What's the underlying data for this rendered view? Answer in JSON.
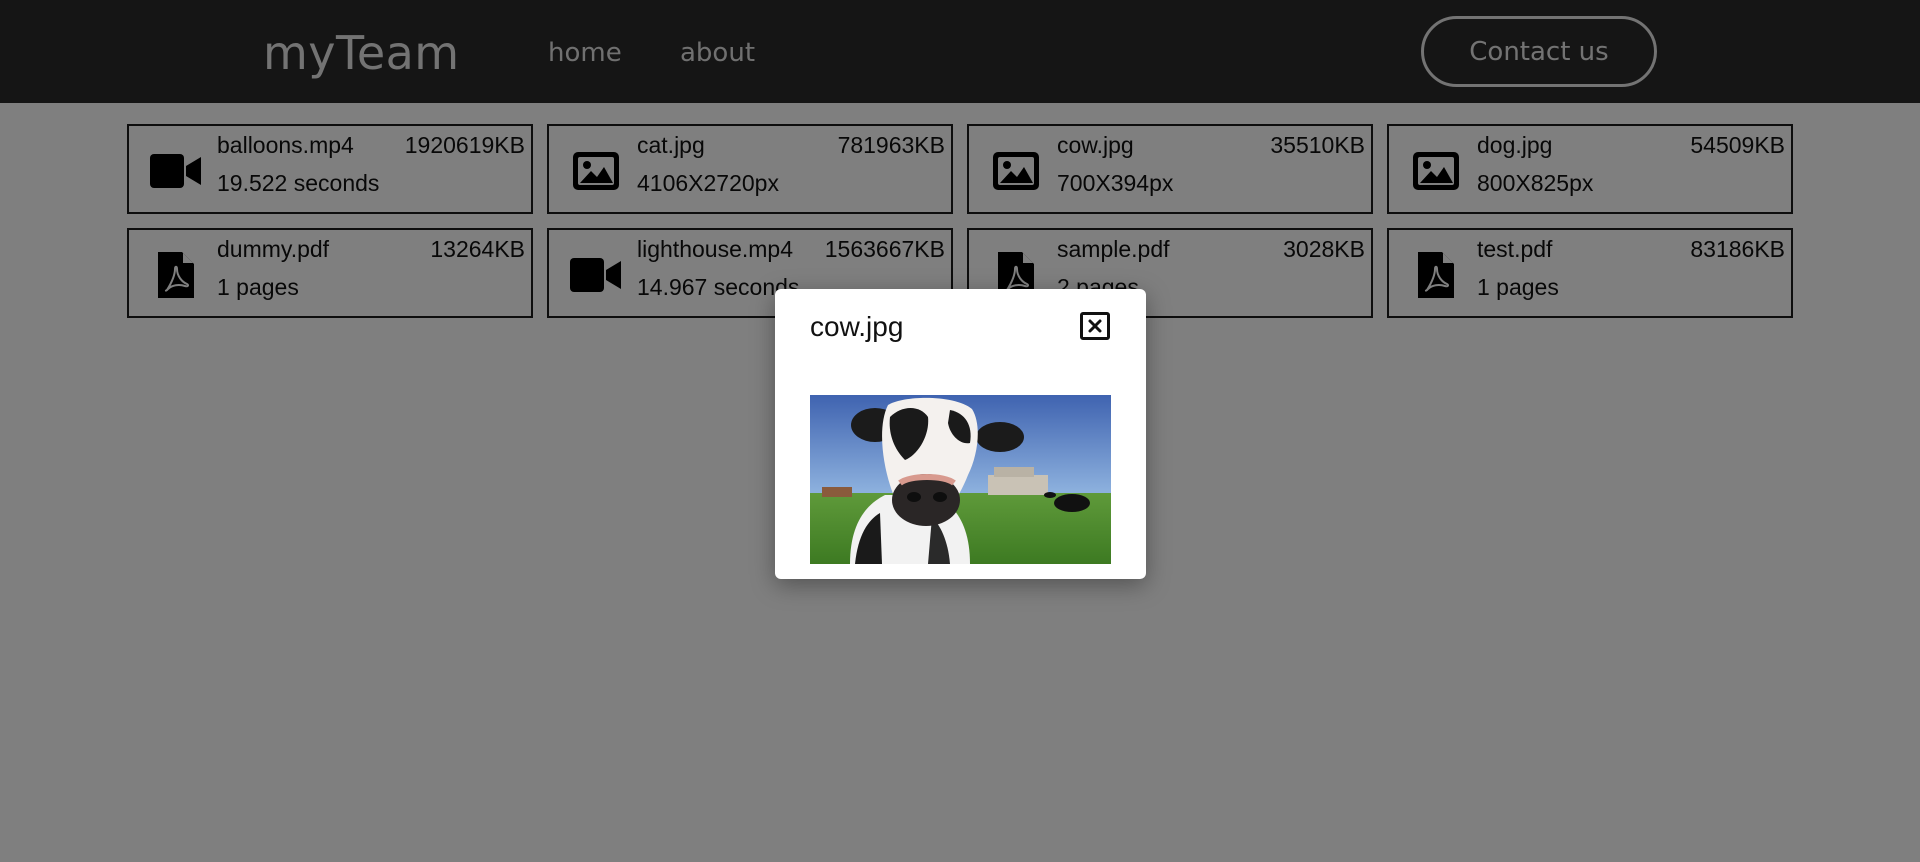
{
  "header": {
    "brand": "myTeam",
    "nav": [
      {
        "label": "home"
      },
      {
        "label": "about"
      }
    ],
    "contact_label": "Contact us"
  },
  "files": [
    {
      "icon": "video-camera-icon",
      "name": "balloons.mp4",
      "size": "1920619KB",
      "meta": "19.522 seconds"
    },
    {
      "icon": "image-icon",
      "name": "cat.jpg",
      "size": "781963KB",
      "meta": "4106X2720px"
    },
    {
      "icon": "image-icon",
      "name": "cow.jpg",
      "size": "35510KB",
      "meta": "700X394px"
    },
    {
      "icon": "image-icon",
      "name": "dog.jpg",
      "size": "54509KB",
      "meta": "800X825px"
    },
    {
      "icon": "pdf-file-icon",
      "name": "dummy.pdf",
      "size": "13264KB",
      "meta": "1 pages"
    },
    {
      "icon": "video-camera-icon",
      "name": "lighthouse.mp4",
      "size": "1563667KB",
      "meta": "14.967 seconds"
    },
    {
      "icon": "pdf-file-icon",
      "name": "sample.pdf",
      "size": "3028KB",
      "meta": "2 pages"
    },
    {
      "icon": "pdf-file-icon",
      "name": "test.pdf",
      "size": "83186KB",
      "meta": "1 pages"
    }
  ],
  "modal": {
    "title": "cow.jpg",
    "close_icon": "close-icon",
    "image_subject": "cow-photo"
  },
  "colors": {
    "navbar": "#2b2b2b",
    "overlay": "rgba(0,0,0,0.5)",
    "card_border": "#1a1a1a"
  }
}
